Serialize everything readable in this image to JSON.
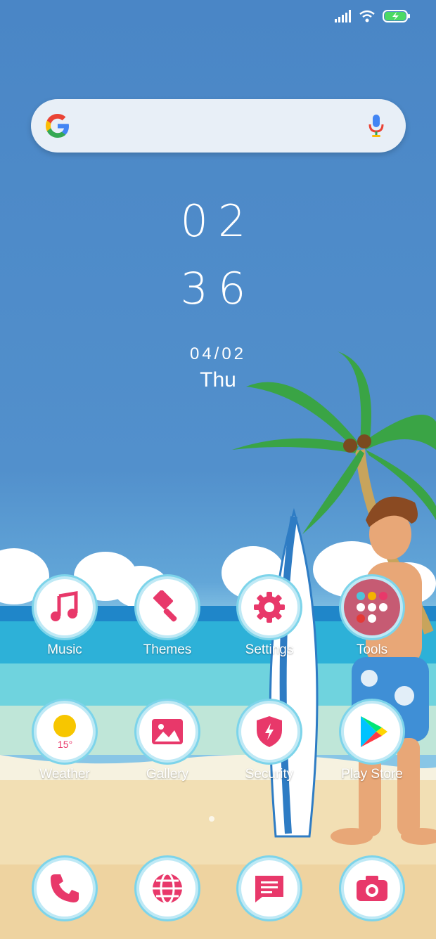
{
  "search": {
    "placeholder": ""
  },
  "clock": {
    "hour": "02",
    "minute": "36",
    "date": "04/02",
    "weekday": "Thu"
  },
  "apps_row1": [
    {
      "label": "Music",
      "icon": "music-note-icon"
    },
    {
      "label": "Themes",
      "icon": "paintbrush-icon"
    },
    {
      "label": "Settings",
      "icon": "gear-icon"
    },
    {
      "label": "Tools",
      "icon": "folder-icon"
    }
  ],
  "apps_row2": [
    {
      "label": "Weather",
      "icon": "weather-sun-icon",
      "temp": "15°"
    },
    {
      "label": "Gallery",
      "icon": "image-icon"
    },
    {
      "label": "Security",
      "icon": "shield-icon"
    },
    {
      "label": "Play Store",
      "icon": "play-store-icon"
    }
  ],
  "dock": [
    {
      "icon": "phone-icon"
    },
    {
      "icon": "browser-globe-icon"
    },
    {
      "icon": "messages-icon"
    },
    {
      "icon": "camera-icon"
    }
  ],
  "colors": {
    "accent": "#e8386a",
    "sky": "#4a86c6"
  }
}
